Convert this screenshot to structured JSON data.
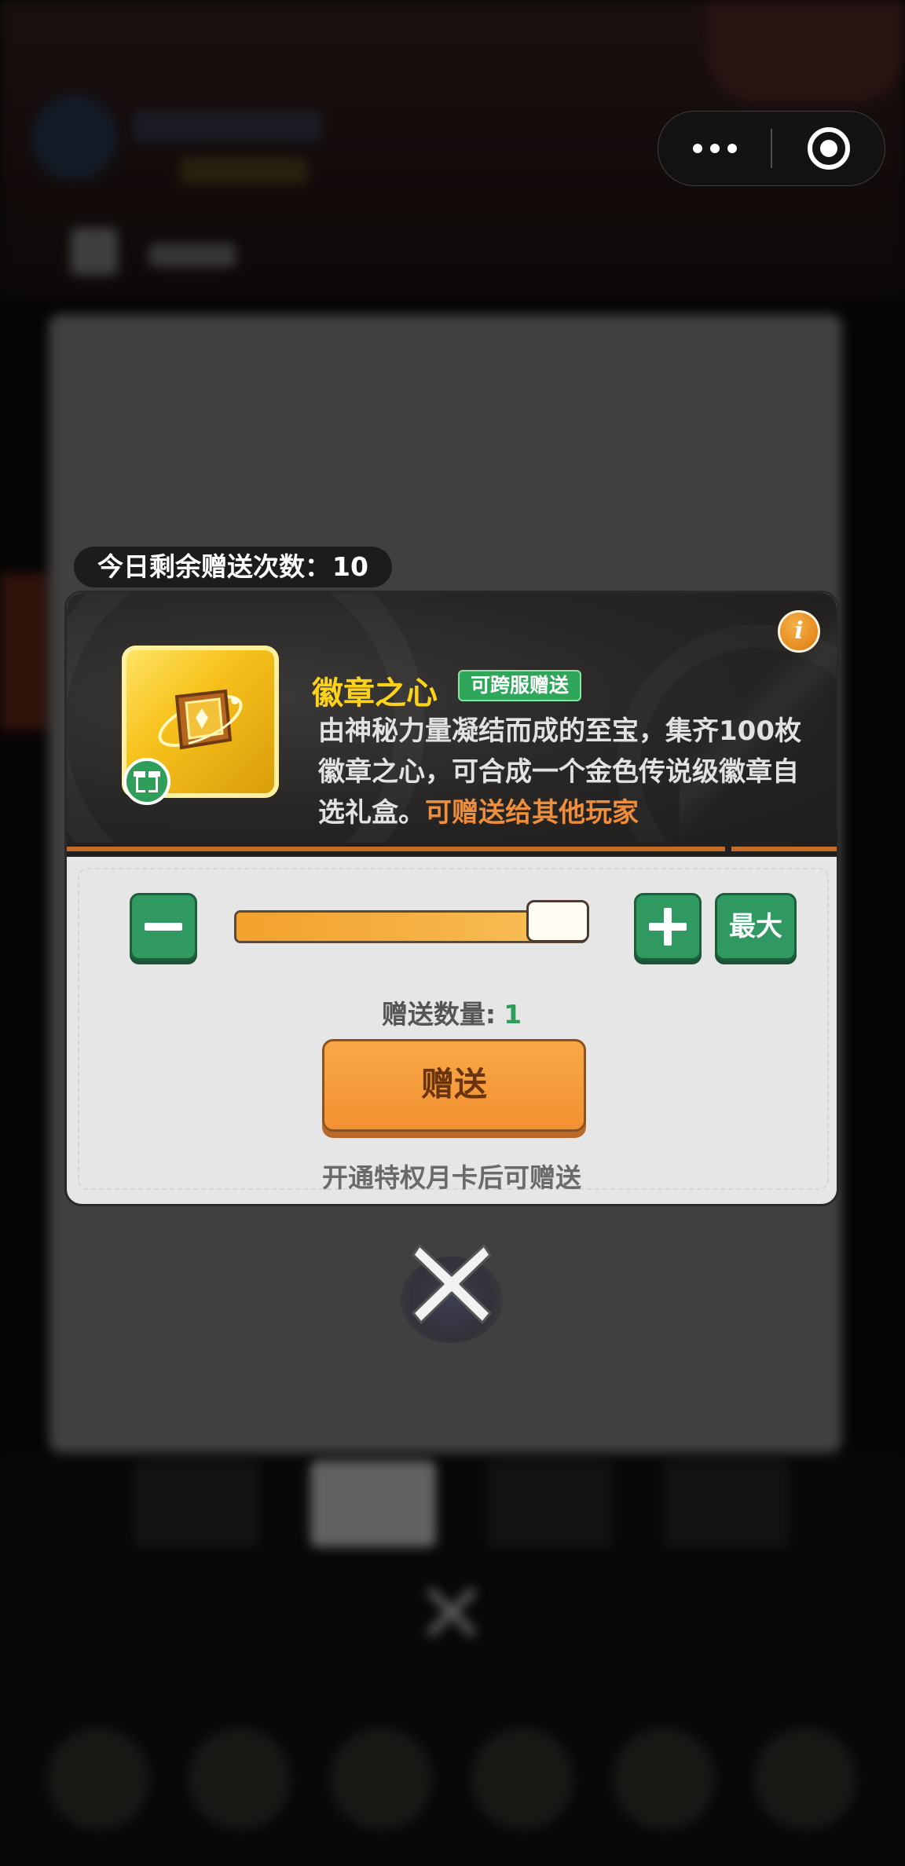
{
  "capsule": {
    "more_icon": "more-dots-icon",
    "close_icon": "target-circle-icon"
  },
  "gift": {
    "remaining_label": "今日剩余赠送次数：",
    "remaining_value": "10"
  },
  "item": {
    "name": "徽章之心",
    "badge": "可跨服赠送",
    "description": "由神秘力量凝结而成的至宝，集齐100枚徽章之心，可合成一个金色传说级徽章自选礼盒。",
    "description_highlight": "可赠送给其他玩家",
    "icon": "badge-heart-icon",
    "gift_icon": "gift-icon",
    "info_icon": "info-icon"
  },
  "controls": {
    "minus_icon": "minus-icon",
    "plus_icon": "plus-icon",
    "max_label": "最大",
    "slider_fraction": 1.0
  },
  "quantity": {
    "label": "赠送数量:",
    "value": "1"
  },
  "actions": {
    "give_label": "赠送",
    "hint": "开通特权月卡后可赠送",
    "close_icon": "close-x-icon"
  },
  "colors": {
    "accent_orange": "#f29132",
    "accent_green": "#2f9961",
    "name_yellow": "#ffd21a",
    "highlight_orange": "#ef8d3a"
  }
}
